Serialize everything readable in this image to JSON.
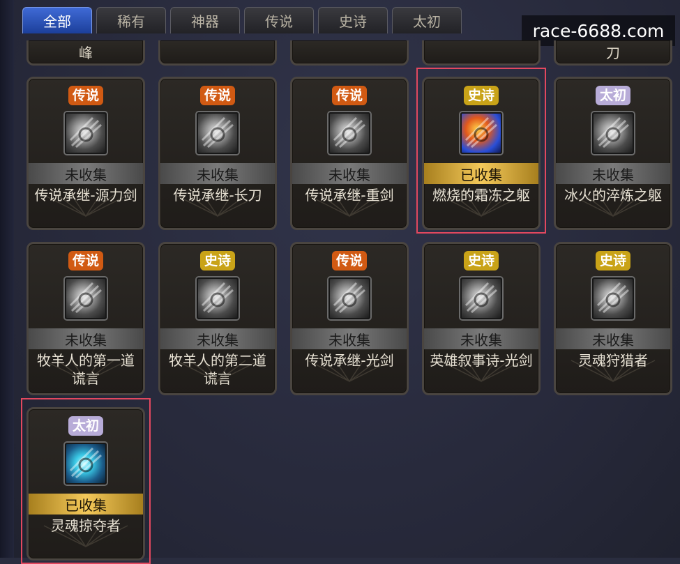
{
  "tabs": [
    {
      "label": "全部",
      "active": true
    },
    {
      "label": "稀有",
      "active": false
    },
    {
      "label": "神器",
      "active": false
    },
    {
      "label": "传说",
      "active": false
    },
    {
      "label": "史诗",
      "active": false
    },
    {
      "label": "太初",
      "active": false
    }
  ],
  "watermark": "race-6688.com",
  "partial_row": [
    "峰",
    "",
    "",
    "",
    "刀"
  ],
  "colors": {
    "legend": "#d15a13",
    "epic": "#c9a318",
    "primordial": "#b8acd8",
    "collected": "#f4c95a",
    "highlight": "#e2485f"
  },
  "cards": [
    {
      "rarity": "传说",
      "rarity_type": "legend",
      "status": "未收集",
      "collected": false,
      "name": "传说承继-源力剑",
      "icon": "sword-relic-icon"
    },
    {
      "rarity": "传说",
      "rarity_type": "legend",
      "status": "未收集",
      "collected": false,
      "name": "传说承继-长刀",
      "icon": "longblade-relic-icon"
    },
    {
      "rarity": "传说",
      "rarity_type": "legend",
      "status": "未收集",
      "collected": false,
      "name": "传说承继-重剑",
      "icon": "greatsword-relic-icon"
    },
    {
      "rarity": "史诗",
      "rarity_type": "epic",
      "status": "已收集",
      "collected": true,
      "name": "燃烧的霜冻之躯",
      "icon": "fire-frost-icon",
      "highlighted": true
    },
    {
      "rarity": "太初",
      "rarity_type": "primordial",
      "status": "未收集",
      "collected": false,
      "name": "冰火的淬炼之躯",
      "icon": "ice-fire-icon"
    },
    {
      "rarity": "传说",
      "rarity_type": "legend",
      "status": "未收集",
      "collected": false,
      "name": "牧羊人的第一道谎言",
      "icon": "shepherd-first-icon"
    },
    {
      "rarity": "史诗",
      "rarity_type": "epic",
      "status": "未收集",
      "collected": false,
      "name": "牧羊人的第二道谎言",
      "icon": "shepherd-second-icon"
    },
    {
      "rarity": "传说",
      "rarity_type": "legend",
      "status": "未收集",
      "collected": false,
      "name": "传说承继-光剑",
      "icon": "lightsword-relic-icon"
    },
    {
      "rarity": "史诗",
      "rarity_type": "epic",
      "status": "未收集",
      "collected": false,
      "name": "英雄叙事诗-光剑",
      "icon": "hero-ballad-icon"
    },
    {
      "rarity": "史诗",
      "rarity_type": "epic",
      "status": "未收集",
      "collected": false,
      "name": "灵魂狩猎者",
      "icon": "soul-hunter-icon"
    },
    {
      "rarity": "太初",
      "rarity_type": "primordial",
      "status": "已收集",
      "collected": true,
      "name": "灵魂掠夺者",
      "icon": "soul-plunderer-icon",
      "highlighted": true
    }
  ]
}
